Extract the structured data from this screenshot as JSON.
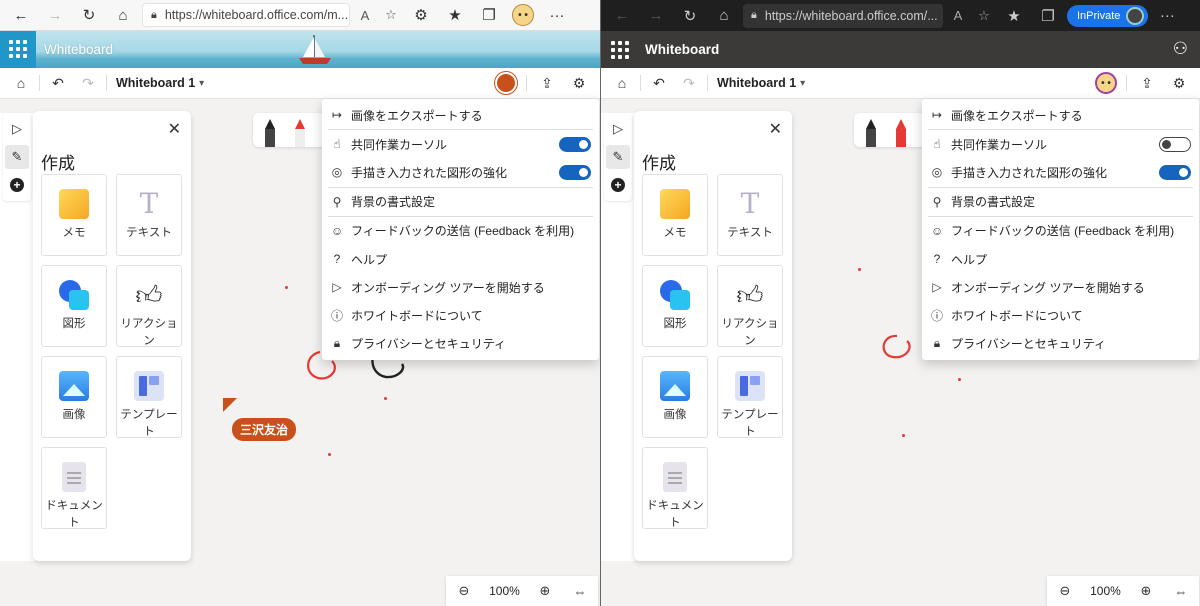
{
  "left": {
    "browser": {
      "url": "https://whiteboard.office.com/m...",
      "read_aloud": "A",
      "avatar_text": "• •"
    },
    "app_name": "Whiteboard",
    "board_title": "Whiteboard 1",
    "create_panel": {
      "title": "作成",
      "tiles": [
        {
          "label": "メモ"
        },
        {
          "label": "テキスト"
        },
        {
          "label": "図形"
        },
        {
          "label": "リアクション"
        },
        {
          "label": "画像"
        },
        {
          "label": "テンプレート"
        },
        {
          "label": "ドキュメント"
        }
      ]
    },
    "menu": {
      "items": [
        {
          "label": "画像をエクスポートする",
          "icon": "export-arrow-icon"
        },
        {
          "label": "共同作業カーソル",
          "icon": "cursor-hand-icon",
          "toggle": true
        },
        {
          "label": "手描き入力された図形の強化",
          "icon": "shapes-icon",
          "toggle": true
        },
        {
          "label": "背景の書式設定",
          "icon": "paint-brush-icon"
        },
        {
          "label": "フィードバックの送信 (Feedback を利用)",
          "icon": "feedback-person-icon"
        },
        {
          "label": "ヘルプ",
          "icon": "question-icon"
        },
        {
          "label": "オンボーディング ツアーを開始する",
          "icon": "play-icon"
        },
        {
          "label": "ホワイトボードについて",
          "icon": "info-icon"
        },
        {
          "label": "プライバシーとセキュリティ",
          "icon": "lock-icon"
        }
      ]
    },
    "cursor_label": "三沢友治",
    "zoom": "100%",
    "accent_color": "#c8501a"
  },
  "right": {
    "browser": {
      "url": "https://whiteboard.office.com/...",
      "read_aloud": "A",
      "inprivate_label": "InPrivate"
    },
    "app_name": "Whiteboard",
    "board_title": "Whiteboard 1",
    "create_panel": {
      "title": "作成",
      "tiles": [
        {
          "label": "メモ"
        },
        {
          "label": "テキスト"
        },
        {
          "label": "図形"
        },
        {
          "label": "リアクション"
        },
        {
          "label": "画像"
        },
        {
          "label": "テンプレート"
        },
        {
          "label": "ドキュメント"
        }
      ]
    },
    "menu": {
      "items": [
        {
          "label": "画像をエクスポートする",
          "icon": "export-arrow-icon"
        },
        {
          "label": "共同作業カーソル",
          "icon": "cursor-hand-icon",
          "toggle": false
        },
        {
          "label": "手描き入力された図形の強化",
          "icon": "shapes-icon",
          "toggle": true
        },
        {
          "label": "背景の書式設定",
          "icon": "paint-brush-icon"
        },
        {
          "label": "フィードバックの送信 (Feedback を利用)",
          "icon": "feedback-person-icon"
        },
        {
          "label": "ヘルプ",
          "icon": "question-icon"
        },
        {
          "label": "オンボーディング ツアーを開始する",
          "icon": "play-icon"
        },
        {
          "label": "ホワイトボードについて",
          "icon": "info-icon"
        },
        {
          "label": "プライバシーとセキュリティ",
          "icon": "lock-icon"
        }
      ]
    },
    "zoom": "100%",
    "accent_color": "#1565c0"
  }
}
